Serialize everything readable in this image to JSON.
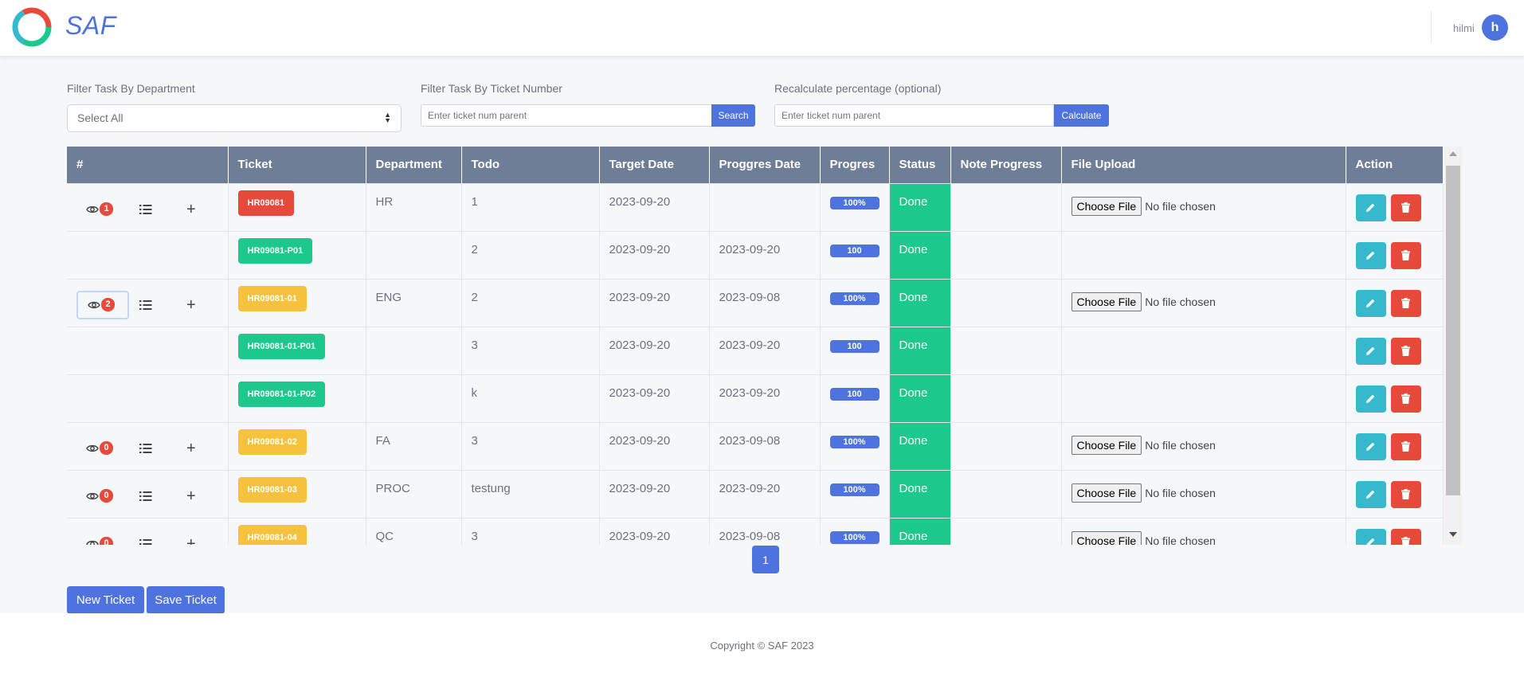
{
  "app": {
    "brand": "SAF",
    "user_name": "hilmi",
    "avatar_initial": "h"
  },
  "filters": {
    "department_label": "Filter Task By Department",
    "department_value": "Select All",
    "ticket_label": "Filter Task By Ticket Number",
    "ticket_placeholder": "Enter ticket num parent",
    "search_label": "Search",
    "recalc_label": "Recalculate percentage (optional)",
    "recalc_placeholder": "Enter ticket num parent",
    "calculate_label": "Calculate"
  },
  "table": {
    "columns": [
      "#",
      "Ticket",
      "Department",
      "Todo",
      "Target Date",
      "Proggres Date",
      "Progres",
      "Status",
      "Note Progress",
      "File Upload",
      "Action"
    ],
    "rows": [
      {
        "count": "1",
        "ticket": "HR09081",
        "ticket_color": "#e74a3b",
        "department": "HR",
        "todo": "1",
        "target_date": "2023-09-20",
        "progress_date": "",
        "progress": "100%",
        "status": "Done",
        "note": "",
        "parent": true
      },
      {
        "count": "",
        "ticket": "HR09081-P01",
        "ticket_color": "#1cc88a",
        "department": "",
        "todo": "2",
        "target_date": "2023-09-20",
        "progress_date": "2023-09-20",
        "progress": "100",
        "status": "Done",
        "note": "",
        "parent": false
      },
      {
        "count": "2",
        "ticket": "HR09081-01",
        "ticket_color": "#f6c23e",
        "department": "ENG",
        "todo": "2",
        "target_date": "2023-09-20",
        "progress_date": "2023-09-08",
        "progress": "100%",
        "status": "Done",
        "note": "",
        "parent": true
      },
      {
        "count": "",
        "ticket": "HR09081-01-P01",
        "ticket_color": "#1cc88a",
        "department": "",
        "todo": "3",
        "target_date": "2023-09-20",
        "progress_date": "2023-09-20",
        "progress": "100",
        "status": "Done",
        "note": "",
        "parent": false
      },
      {
        "count": "",
        "ticket": "HR09081-01-P02",
        "ticket_color": "#1cc88a",
        "department": "",
        "todo": "k",
        "target_date": "2023-09-20",
        "progress_date": "2023-09-20",
        "progress": "100",
        "status": "Done",
        "note": "",
        "parent": false
      },
      {
        "count": "0",
        "ticket": "HR09081-02",
        "ticket_color": "#f6c23e",
        "department": "FA",
        "todo": "3",
        "target_date": "2023-09-20",
        "progress_date": "2023-09-08",
        "progress": "100%",
        "status": "Done",
        "note": "",
        "parent": true
      },
      {
        "count": "0",
        "ticket": "HR09081-03",
        "ticket_color": "#f6c23e",
        "department": "PROC",
        "todo": "testung",
        "target_date": "2023-09-20",
        "progress_date": "2023-09-20",
        "progress": "100%",
        "status": "Done",
        "note": "",
        "parent": true
      },
      {
        "count": "0",
        "ticket": "HR09081-04",
        "ticket_color": "#f6c23e",
        "department": "QC",
        "todo": "3",
        "target_date": "2023-09-20",
        "progress_date": "2023-09-08",
        "progress": "100%",
        "status": "Done",
        "note": "",
        "parent": true
      }
    ],
    "choose_file_label": "Choose File",
    "no_file_label": "No file chosen"
  },
  "pagination": {
    "current_page": "1"
  },
  "actions": {
    "new_ticket_label": "New Ticket",
    "save_ticket_label": "Save Ticket"
  },
  "footer": {
    "copyright": "Copyright © SAF 2023"
  }
}
